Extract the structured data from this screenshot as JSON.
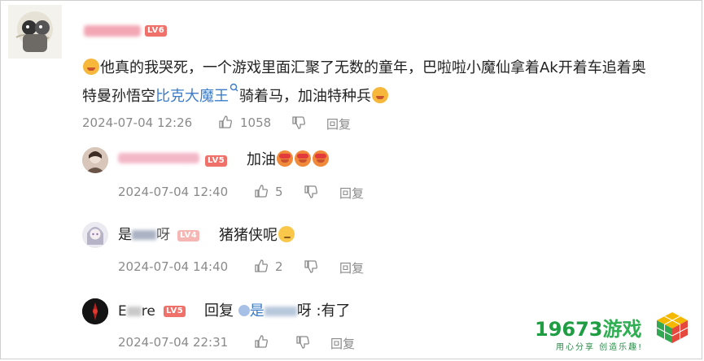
{
  "comment": {
    "username": "",
    "level": "LV6",
    "text_part1": "他真的我哭死，一个游戏里面汇聚了无数的童年，巴啦啦小魔仙拿着Ak开着车追着奥",
    "text_part2_pre": "特曼孙悟空",
    "link_text": "比克大魔王",
    "text_part2_post": "骑着马，加油特种兵",
    "timestamp": "2024-07-04 12:26",
    "likes": "1058",
    "reply_label": "回复"
  },
  "replies": [
    {
      "username": "",
      "level": "LV5",
      "text": "加油",
      "timestamp": "2024-07-04 12:40",
      "likes": "5",
      "reply_label": "回复"
    },
    {
      "username": "是",
      "username_tail": "呀",
      "level": "LV4",
      "text": "猪猪侠呢",
      "timestamp": "2024-07-04 14:40",
      "likes": "2",
      "reply_label": "回复"
    },
    {
      "username": "E",
      "username_tail": "re",
      "level": "LV5",
      "reply_prefix": "回复",
      "reply_target": "是",
      "reply_target_tail": "呀",
      "text": ":有了",
      "timestamp": "2024-07-04 22:31",
      "reply_label": "回复"
    }
  ],
  "watermark": {
    "number": "19673",
    "brand": "游戏",
    "slogan": "用心分享 创造乐趣!"
  },
  "colors": {
    "level_badge": "#f0706a",
    "link": "#3b7cc8",
    "meta_gray": "#8a8a8a",
    "watermark_green": "#1e9d43"
  },
  "icons": [
    "like-icon",
    "dislike-icon",
    "search-icon",
    "emoji-icon"
  ]
}
